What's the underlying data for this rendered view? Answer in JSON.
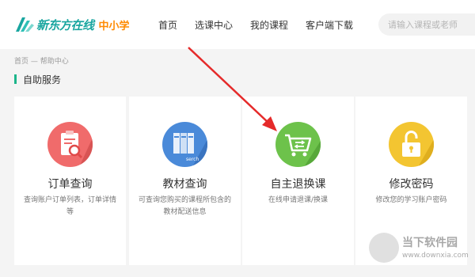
{
  "header": {
    "logo_text": "新东方在线",
    "logo_sub": "中小学",
    "nav": [
      "首页",
      "选课中心",
      "我的课程",
      "客户端下载"
    ],
    "search_placeholder": "请输入课程或老师"
  },
  "breadcrumb": "首页 — 帮助中心",
  "section_title": "自助服务",
  "cards": [
    {
      "title": "订单查询",
      "desc": "查询账户订单列表，订单详情等",
      "icon": "order-search-icon",
      "color": "#f06b6b"
    },
    {
      "title": "教材查询",
      "desc": "可查询您购买的课程所包含的教材配送信息",
      "icon": "books-icon",
      "color": "#4a8ad9"
    },
    {
      "title": "自主退换课",
      "desc": "在线申请退课/换课",
      "icon": "cart-exchange-icon",
      "color": "#6dc24b"
    },
    {
      "title": "修改密码",
      "desc": "修改您的学习账户密码",
      "icon": "lock-icon",
      "color": "#f3c531"
    }
  ],
  "icon_text": "serch",
  "watermark": {
    "text": "当下软件园",
    "url": "www.downxia.com"
  },
  "colors": {
    "accent": "#1cb58a",
    "arrow": "#e52a2a"
  }
}
